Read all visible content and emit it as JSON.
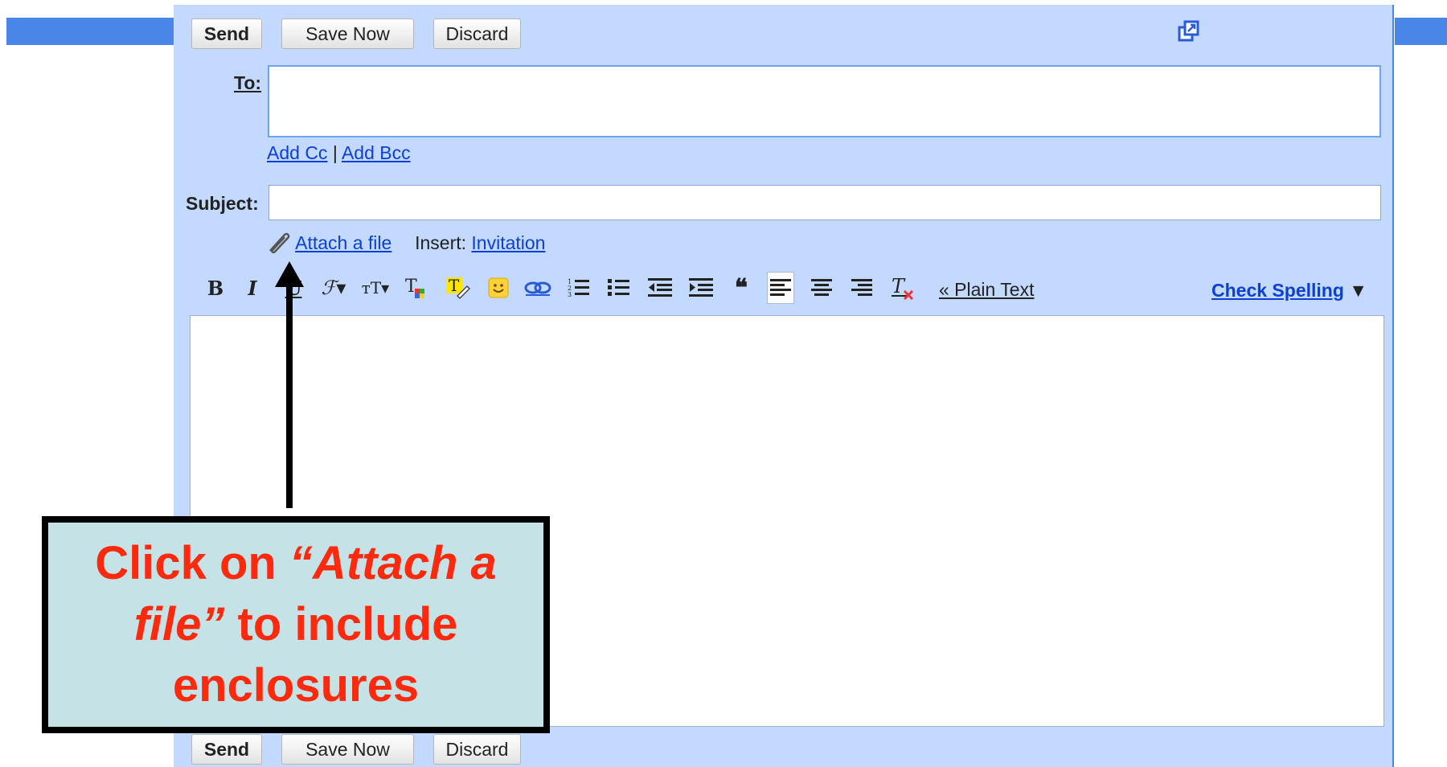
{
  "toolbar_top": {
    "send": "Send",
    "save": "Save Now",
    "discard": "Discard"
  },
  "toolbar_bottom": {
    "send": "Send",
    "save": "Save Now",
    "discard": "Discard"
  },
  "to": {
    "label": "To:",
    "value": ""
  },
  "cc_bcc": {
    "add_cc": "Add Cc",
    "separator": "|",
    "add_bcc": "Add Bcc"
  },
  "subject": {
    "label": "Subject:",
    "value": ""
  },
  "attach": {
    "link": "Attach a file",
    "insert_label": "Insert:",
    "invitation": "Invitation"
  },
  "format_toolbar": {
    "plain_text": "« Plain Text",
    "check_spelling": "Check Spelling",
    "caret": "▼"
  },
  "callout": {
    "part1": "Click on ",
    "quoted": "“Attach a file”",
    "part2": " to include enclosures"
  },
  "icons": [
    "popout-icon",
    "paperclip-icon",
    "bold-icon",
    "italic-icon",
    "underline-icon",
    "font-icon",
    "font-size-icon",
    "text-color-icon",
    "highlight-icon",
    "emoticon-icon",
    "link-icon",
    "numbered-list-icon",
    "bulleted-list-icon",
    "indent-less-icon",
    "indent-more-icon",
    "quote-icon",
    "align-left-icon",
    "align-center-icon",
    "align-right-icon",
    "remove-formatting-icon"
  ],
  "colors": {
    "compose_bg": "#c3d9ff",
    "link": "#0b3fd8",
    "callout_bg": "#c5e3e7",
    "callout_text": "#ff2a0e"
  }
}
